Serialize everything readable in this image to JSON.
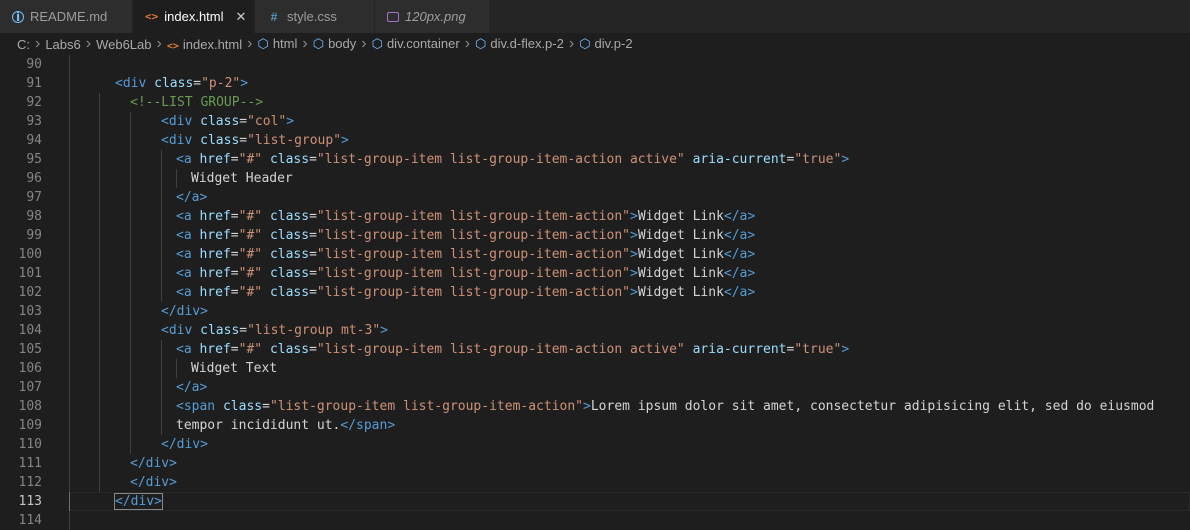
{
  "tabs": [
    {
      "label": "README.md",
      "icon": "info-icon",
      "active": false
    },
    {
      "label": "index.html",
      "icon": "html-icon",
      "active": true
    },
    {
      "label": "style.css",
      "icon": "css-icon",
      "active": false
    },
    {
      "label": "120px.png",
      "icon": "image-icon",
      "active": false
    }
  ],
  "breadcrumb": [
    "C:",
    "Labs6",
    "Web6Lab",
    "index.html",
    "html",
    "body",
    "div.container",
    "div.d-flex.p-2",
    "div.p-2"
  ],
  "lines": [
    {
      "n": "90",
      "indent": 0,
      "tokens": []
    },
    {
      "n": "91",
      "indent": 1,
      "tokens": [
        [
          "tag",
          "<div "
        ],
        [
          "attr",
          "class"
        ],
        [
          "eq",
          "="
        ],
        [
          "str",
          "\"p-2\""
        ],
        [
          "tag",
          ">"
        ]
      ]
    },
    {
      "n": "92",
      "indent": 2,
      "tokens": [
        [
          "cmt",
          "<!--LIST GROUP-->"
        ]
      ]
    },
    {
      "n": "93",
      "indent": 3,
      "tokens": [
        [
          "tag",
          "<div "
        ],
        [
          "attr",
          "class"
        ],
        [
          "eq",
          "="
        ],
        [
          "str",
          "\"col\""
        ],
        [
          "tag",
          ">"
        ]
      ]
    },
    {
      "n": "94",
      "indent": 3,
      "tokens": [
        [
          "tag",
          "<div "
        ],
        [
          "attr",
          "class"
        ],
        [
          "eq",
          "="
        ],
        [
          "str",
          "\"list-group\""
        ],
        [
          "tag",
          ">"
        ]
      ]
    },
    {
      "n": "95",
      "indent": 4,
      "tokens": [
        [
          "tag",
          "<a "
        ],
        [
          "attr",
          "href"
        ],
        [
          "eq",
          "="
        ],
        [
          "str",
          "\"#\""
        ],
        [
          "txt",
          " "
        ],
        [
          "attr",
          "class"
        ],
        [
          "eq",
          "="
        ],
        [
          "str",
          "\"list-group-item list-group-item-action active\""
        ],
        [
          "txt",
          " "
        ],
        [
          "attr",
          "aria-current"
        ],
        [
          "eq",
          "="
        ],
        [
          "str",
          "\"true\""
        ],
        [
          "tag",
          ">"
        ]
      ]
    },
    {
      "n": "96",
      "indent": 5,
      "tokens": [
        [
          "txt",
          "Widget Header"
        ]
      ]
    },
    {
      "n": "97",
      "indent": 4,
      "tokens": [
        [
          "tag",
          "</a>"
        ]
      ]
    },
    {
      "n": "98",
      "indent": 4,
      "tokens": [
        [
          "tag",
          "<a "
        ],
        [
          "attr",
          "href"
        ],
        [
          "eq",
          "="
        ],
        [
          "str",
          "\"#\""
        ],
        [
          "txt",
          " "
        ],
        [
          "attr",
          "class"
        ],
        [
          "eq",
          "="
        ],
        [
          "str",
          "\"list-group-item list-group-item-action\""
        ],
        [
          "tag",
          ">"
        ],
        [
          "txt",
          "Widget Link"
        ],
        [
          "tag",
          "</a>"
        ]
      ]
    },
    {
      "n": "99",
      "indent": 4,
      "tokens": [
        [
          "tag",
          "<a "
        ],
        [
          "attr",
          "href"
        ],
        [
          "eq",
          "="
        ],
        [
          "str",
          "\"#\""
        ],
        [
          "txt",
          " "
        ],
        [
          "attr",
          "class"
        ],
        [
          "eq",
          "="
        ],
        [
          "str",
          "\"list-group-item list-group-item-action\""
        ],
        [
          "tag",
          ">"
        ],
        [
          "txt",
          "Widget Link"
        ],
        [
          "tag",
          "</a>"
        ]
      ]
    },
    {
      "n": "100",
      "indent": 4,
      "tokens": [
        [
          "tag",
          "<a "
        ],
        [
          "attr",
          "href"
        ],
        [
          "eq",
          "="
        ],
        [
          "str",
          "\"#\""
        ],
        [
          "txt",
          " "
        ],
        [
          "attr",
          "class"
        ],
        [
          "eq",
          "="
        ],
        [
          "str",
          "\"list-group-item list-group-item-action\""
        ],
        [
          "tag",
          ">"
        ],
        [
          "txt",
          "Widget Link"
        ],
        [
          "tag",
          "</a>"
        ]
      ]
    },
    {
      "n": "101",
      "indent": 4,
      "tokens": [
        [
          "tag",
          "<a "
        ],
        [
          "attr",
          "href"
        ],
        [
          "eq",
          "="
        ],
        [
          "str",
          "\"#\""
        ],
        [
          "txt",
          " "
        ],
        [
          "attr",
          "class"
        ],
        [
          "eq",
          "="
        ],
        [
          "str",
          "\"list-group-item list-group-item-action\""
        ],
        [
          "tag",
          ">"
        ],
        [
          "txt",
          "Widget Link"
        ],
        [
          "tag",
          "</a>"
        ]
      ]
    },
    {
      "n": "102",
      "indent": 4,
      "tokens": [
        [
          "tag",
          "<a "
        ],
        [
          "attr",
          "href"
        ],
        [
          "eq",
          "="
        ],
        [
          "str",
          "\"#\""
        ],
        [
          "txt",
          " "
        ],
        [
          "attr",
          "class"
        ],
        [
          "eq",
          "="
        ],
        [
          "str",
          "\"list-group-item list-group-item-action\""
        ],
        [
          "tag",
          ">"
        ],
        [
          "txt",
          "Widget Link"
        ],
        [
          "tag",
          "</a>"
        ]
      ]
    },
    {
      "n": "103",
      "indent": 3,
      "tokens": [
        [
          "tag",
          "</div>"
        ]
      ]
    },
    {
      "n": "104",
      "indent": 3,
      "tokens": [
        [
          "tag",
          "<div "
        ],
        [
          "attr",
          "class"
        ],
        [
          "eq",
          "="
        ],
        [
          "str",
          "\"list-group mt-3\""
        ],
        [
          "tag",
          ">"
        ]
      ]
    },
    {
      "n": "105",
      "indent": 4,
      "tokens": [
        [
          "tag",
          "<a "
        ],
        [
          "attr",
          "href"
        ],
        [
          "eq",
          "="
        ],
        [
          "str",
          "\"#\""
        ],
        [
          "txt",
          " "
        ],
        [
          "attr",
          "class"
        ],
        [
          "eq",
          "="
        ],
        [
          "str",
          "\"list-group-item list-group-item-action active\""
        ],
        [
          "txt",
          " "
        ],
        [
          "attr",
          "aria-current"
        ],
        [
          "eq",
          "="
        ],
        [
          "str",
          "\"true\""
        ],
        [
          "tag",
          ">"
        ]
      ]
    },
    {
      "n": "106",
      "indent": 5,
      "tokens": [
        [
          "txt",
          "Widget Text"
        ]
      ]
    },
    {
      "n": "107",
      "indent": 4,
      "tokens": [
        [
          "tag",
          "</a>"
        ]
      ]
    },
    {
      "n": "108",
      "indent": 4,
      "tokens": [
        [
          "tag",
          "<span "
        ],
        [
          "attr",
          "class"
        ],
        [
          "eq",
          "="
        ],
        [
          "str",
          "\"list-group-item list-group-item-action\""
        ],
        [
          "tag",
          ">"
        ],
        [
          "txt",
          "Lorem ipsum dolor sit amet, consectetur adipisicing elit, sed do eiusmod"
        ]
      ]
    },
    {
      "n": "109",
      "indent": 4,
      "tokens": [
        [
          "txt",
          "tempor incididunt ut."
        ],
        [
          "tag",
          "</span>"
        ]
      ]
    },
    {
      "n": "110",
      "indent": 3,
      "tokens": [
        [
          "tag",
          "</div>"
        ]
      ]
    },
    {
      "n": "111",
      "indent": 2,
      "tokens": [
        [
          "tag",
          "</div>"
        ]
      ]
    },
    {
      "n": "112",
      "indent": 2,
      "tokens": [
        [
          "tag",
          "</div>"
        ]
      ]
    },
    {
      "n": "113",
      "indent": 1,
      "current": true,
      "tokens": [
        [
          "tag",
          "</div>"
        ]
      ]
    },
    {
      "n": "114",
      "indent": 0,
      "tokens": []
    }
  ]
}
